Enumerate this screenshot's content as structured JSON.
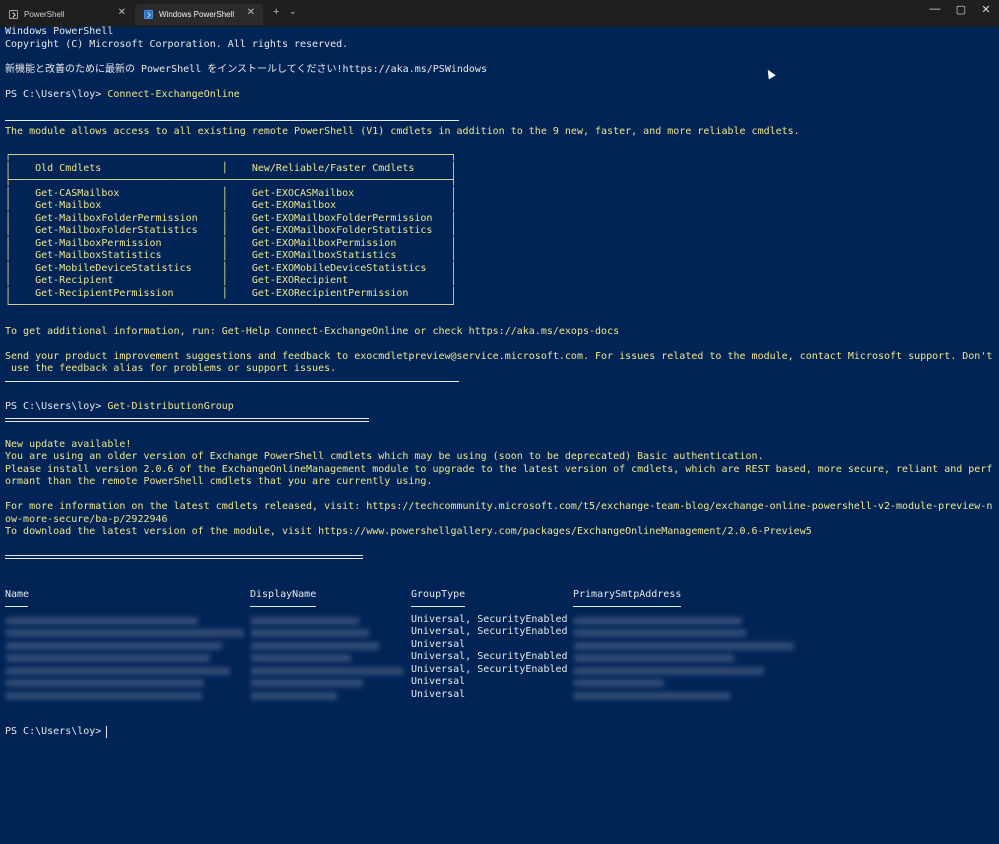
{
  "tabs": [
    {
      "title": "PowerShell",
      "active": false
    },
    {
      "title": "Windows PowerShell",
      "active": true
    }
  ],
  "tabbar": {
    "new_tab": "+",
    "dropdown": "⌄",
    "close": "✕"
  },
  "window_controls": {
    "minimize": "—",
    "maximize": "▢",
    "close": "✕"
  },
  "colors": {
    "background": "#012456",
    "text": "#e8e8e8",
    "warning": "#f0e68c",
    "titlebar": "#1f1f1f"
  },
  "terminal": {
    "header": [
      "Windows PowerShell",
      "Copyright (C) Microsoft Corporation. All rights reserved.",
      "新機能と改善のために最新の PowerShell をインストールしてください!https://aka.ms/PSWindows"
    ],
    "prompt1": "PS C:\\Users\\loy> ",
    "cmd1": "Connect-ExchangeOnline",
    "module_intro": "The module allows access to all existing remote PowerShell (V1) cmdlets in addition to the 9 new, faster, and more reliable cmdlets.",
    "table_box": {
      "top": "┌─────────────────────────────────────────────────────────────────────────┐",
      "sep": "├─────────────────────────────────────────────────────────────────────────┤",
      "bottom": "└─────────────────────────────────────────────────────────────────────────┘",
      "header": "│    Old Cmdlets                    │    New/Reliable/Faster Cmdlets      │",
      "blank": "│                                   │                                     │",
      "rows": [
        "│    Get-CASMailbox                 │    Get-EXOCASMailbox                │",
        "│    Get-Mailbox                    │    Get-EXOMailbox                   │",
        "│    Get-MailboxFolderPermission    │    Get-EXOMailboxFolderPermission   │",
        "│    Get-MailboxFolderStatistics    │    Get-EXOMailboxFolderStatistics   │",
        "│    Get-MailboxPermission          │    Get-EXOMailboxPermission         │",
        "│    Get-MailboxStatistics          │    Get-EXOMailboxStatistics         │",
        "│    Get-MobileDeviceStatistics     │    Get-EXOMobileDeviceStatistics    │",
        "│    Get-Recipient                  │    Get-EXORecipient                 │",
        "│    Get-RecipientPermission        │    Get-EXORecipientPermission       │"
      ]
    },
    "help_info": "To get additional information, run: Get-Help Connect-ExchangeOnline or check https://aka.ms/exops-docs",
    "feedback_1": "Send your product improvement suggestions and feedback to exocmdletpreview@service.microsoft.com. For issues related to the module, contact Microsoft support. Don't",
    "feedback_2": " use the feedback alias for problems or support issues.",
    "prompt2": "PS C:\\Users\\loy> ",
    "cmd2": "Get-DistributionGroup",
    "update": [
      "New update available!",
      "You are using an older version of Exchange PowerShell cmdlets which may be using (soon to be deprecated) Basic authentication.",
      "Please install version 2.0.6 of the ExchangeOnlineManagement module to upgrade to the latest version of cmdlets, which are REST based, more secure, reliant and perf",
      "ormant than the remote PowerShell cmdlets that you are currently using.",
      "For more information on the latest cmdlets released, visit: https://techcommunity.microsoft.com/t5/exchange-team-blog/exchange-online-powershell-v2-module-preview-n",
      "ow-more-secure/ba-p/2922946",
      "To download the latest version of the module, visit https://www.powershellgallery.com/packages/ExchangeOnlineManagement/2.0.6-Preview5"
    ],
    "columns": [
      "Name",
      "DisplayName",
      "GroupType",
      "PrimarySmtpAddress"
    ],
    "group_types": [
      "Universal, SecurityEnabled",
      "Universal, SecurityEnabled",
      "Universal",
      "Universal, SecurityEnabled",
      "Universal, SecurityEnabled",
      "Universal",
      "Universal"
    ],
    "prompt3": "PS C:\\Users\\loy> "
  }
}
